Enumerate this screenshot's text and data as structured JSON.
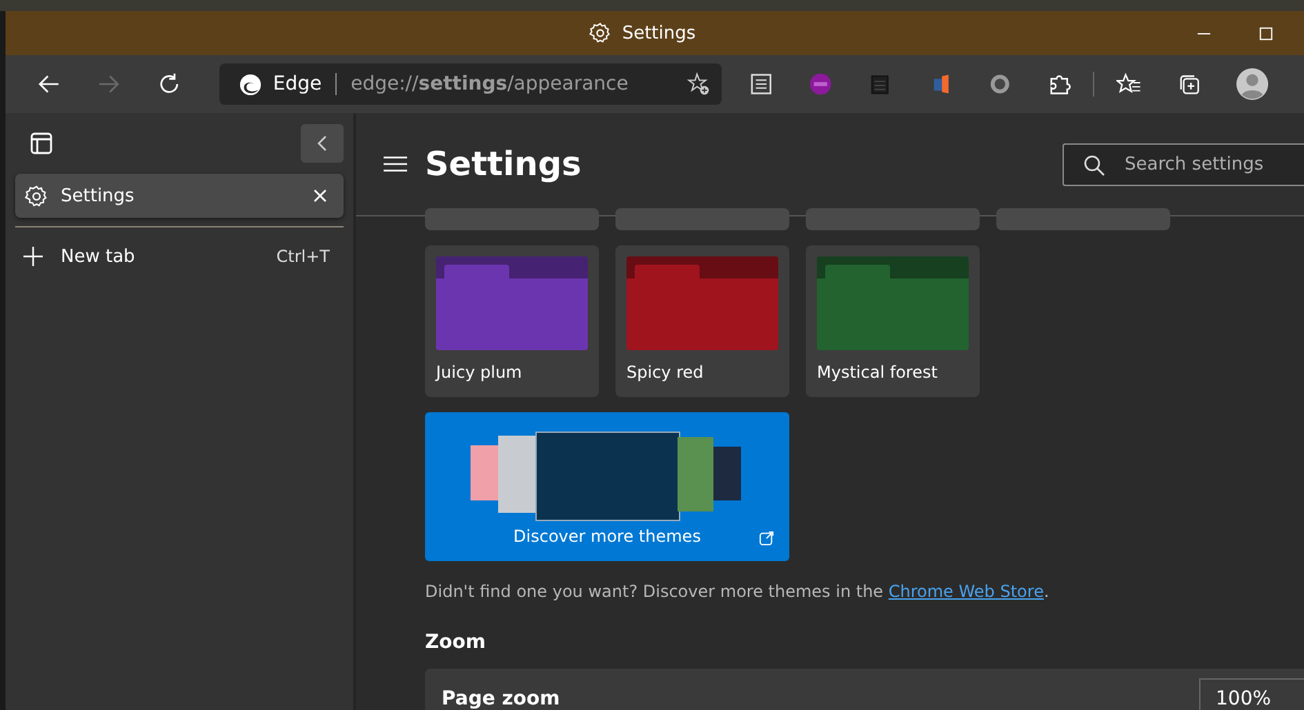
{
  "window": {
    "title": "Settings"
  },
  "toolbar": {
    "back": {
      "disabled": false
    },
    "forward": {
      "disabled": true
    },
    "address": {
      "site": "Edge",
      "url": "edge://**settings**/appearance"
    }
  },
  "sidebar": {
    "tabs": [
      {
        "label": "Settings",
        "selected": true
      }
    ],
    "new_tab": {
      "label": "New tab",
      "shortcut": "Ctrl+T"
    }
  },
  "header": {
    "title": "Settings",
    "search": {
      "placeholder": "Search settings"
    }
  },
  "themes": [
    {
      "kind": "clipped",
      "color": "#4a4a4a"
    },
    {
      "kind": "clipped",
      "color": "#4a4a4a"
    },
    {
      "kind": "clipped",
      "color": "#4a4a4a"
    },
    {
      "kind": "clipped",
      "color": "#4a4a4a"
    },
    {
      "kind": "folder",
      "name": "Juicy plum",
      "color": "#6c35b0"
    },
    {
      "kind": "folder",
      "name": "Spicy red",
      "color": "#a0141e"
    },
    {
      "kind": "folder",
      "name": "Mystical forest",
      "color": "#226330"
    }
  ],
  "discover": {
    "label": "Discover more themes"
  },
  "store_note": {
    "before": "Didn't find one you want? Discover more themes in the ",
    "link": "Chrome Web Store",
    "after": "."
  },
  "zoom": {
    "heading": "Zoom",
    "row": {
      "label": "Page zoom",
      "value": "100%"
    }
  }
}
